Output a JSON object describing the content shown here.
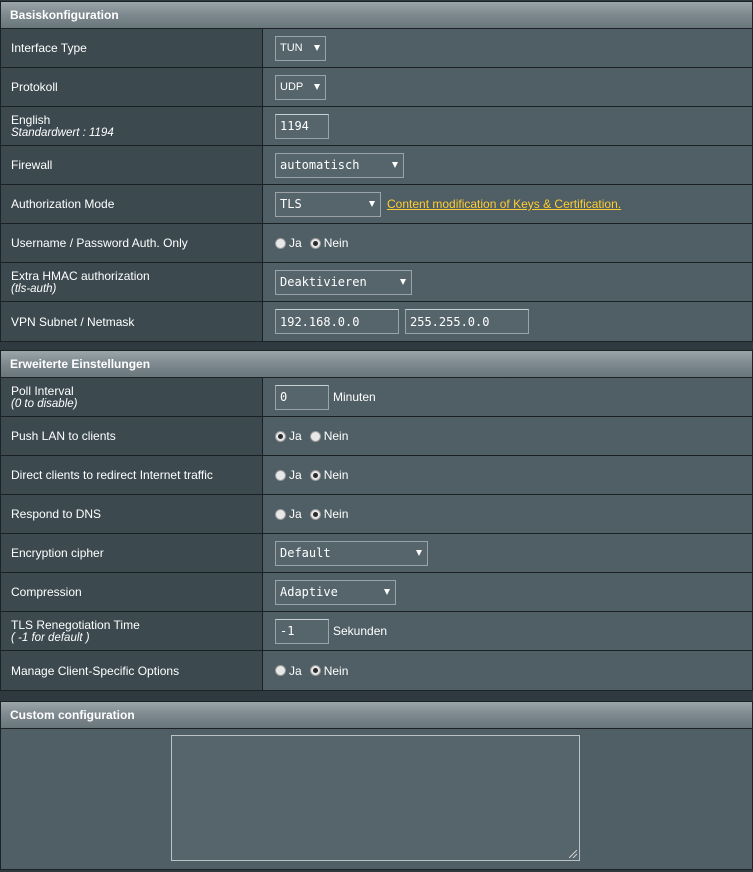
{
  "basic": {
    "title": "Basiskonfiguration",
    "interface_type": {
      "label": "Interface Type",
      "value": "TUN"
    },
    "protocol": {
      "label": "Protokoll",
      "value": "UDP"
    },
    "port": {
      "label": "English",
      "sub": "Standardwert : 1194",
      "value": "1194"
    },
    "firewall": {
      "label": "Firewall",
      "value": "automatisch"
    },
    "auth_mode": {
      "label": "Authorization Mode",
      "value": "TLS",
      "link": "Content modification of Keys & Certification."
    },
    "userpass_only": {
      "label": "Username / Password Auth. Only",
      "yes": "Ja",
      "no": "Nein",
      "selected": "no"
    },
    "hmac": {
      "label": "Extra HMAC authorization",
      "sub": "(tls-auth)",
      "value": "Deaktivieren"
    },
    "subnet": {
      "label": "VPN Subnet / Netmask",
      "subnet": "192.168.0.0",
      "netmask": "255.255.0.0"
    }
  },
  "advanced": {
    "title": "Erweiterte Einstellungen",
    "poll": {
      "label": "Poll Interval",
      "sub": "(0 to disable)",
      "value": "0",
      "unit": "Minuten"
    },
    "push_lan": {
      "label": "Push LAN to clients",
      "yes": "Ja",
      "no": "Nein",
      "selected": "yes"
    },
    "redirect": {
      "label": "Direct clients to redirect Internet traffic",
      "yes": "Ja",
      "no": "Nein",
      "selected": "no"
    },
    "dns": {
      "label": "Respond to DNS",
      "yes": "Ja",
      "no": "Nein",
      "selected": "no"
    },
    "cipher": {
      "label": "Encryption cipher",
      "value": "Default"
    },
    "compression": {
      "label": "Compression",
      "value": "Adaptive"
    },
    "tls_reneg": {
      "label": "TLS Renegotiation Time",
      "sub": "( -1 for default )",
      "value": "-1",
      "unit": "Sekunden"
    },
    "client_specific": {
      "label": "Manage Client-Specific Options",
      "yes": "Ja",
      "no": "Nein",
      "selected": "no"
    }
  },
  "custom": {
    "title": "Custom configuration",
    "value": ""
  }
}
